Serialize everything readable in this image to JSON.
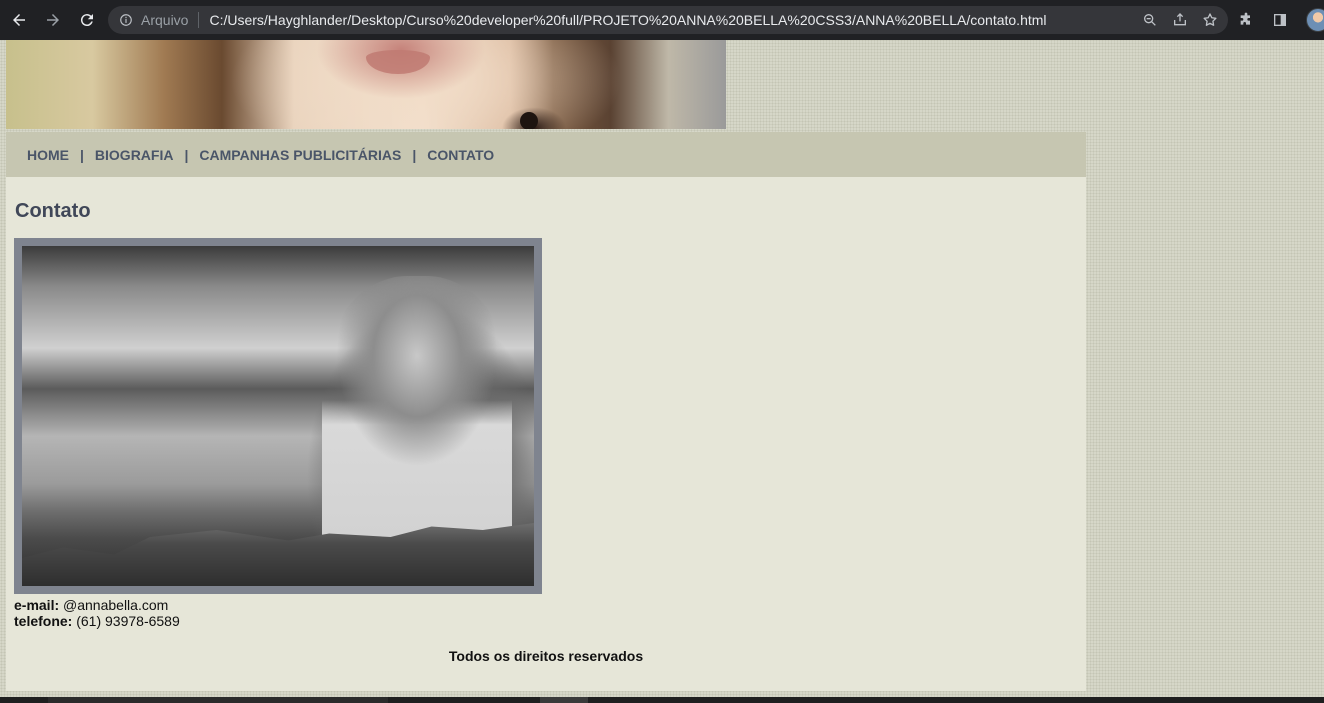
{
  "browser": {
    "scheme_label": "Arquivo",
    "url": "C:/Users/Hayghlander/Desktop/Curso%20developer%20full/PROJETO%20ANNA%20BELLA%20CSS3/ANNA%20BELLA/contato.html",
    "icons": [
      "back-icon",
      "forward-icon",
      "reload-icon",
      "info-icon",
      "zoom-icon",
      "share-icon",
      "star-icon",
      "extensions-icon",
      "side-panel-icon",
      "profile-avatar"
    ]
  },
  "nav": {
    "items": [
      {
        "label": "HOME"
      },
      {
        "label": "BIOGRAFIA"
      },
      {
        "label": "CAMPANHAS PUBLICITÁRIAS"
      },
      {
        "label": "CONTATO"
      }
    ],
    "separator": "|"
  },
  "main": {
    "title": "Contato",
    "contact": {
      "email_label": "e-mail:",
      "email_value": "@annabella.com",
      "phone_label": "telefone:",
      "phone_value": "(61) 93978-6589"
    }
  },
  "footer": {
    "text": "Todos os direitos reservados"
  },
  "colors": {
    "chrome_bg": "#202124",
    "menu_bg": "#c6c6b1",
    "content_bg": "#e6e6d8",
    "link_color": "#4a5568",
    "photo_border": "#7f848f"
  }
}
